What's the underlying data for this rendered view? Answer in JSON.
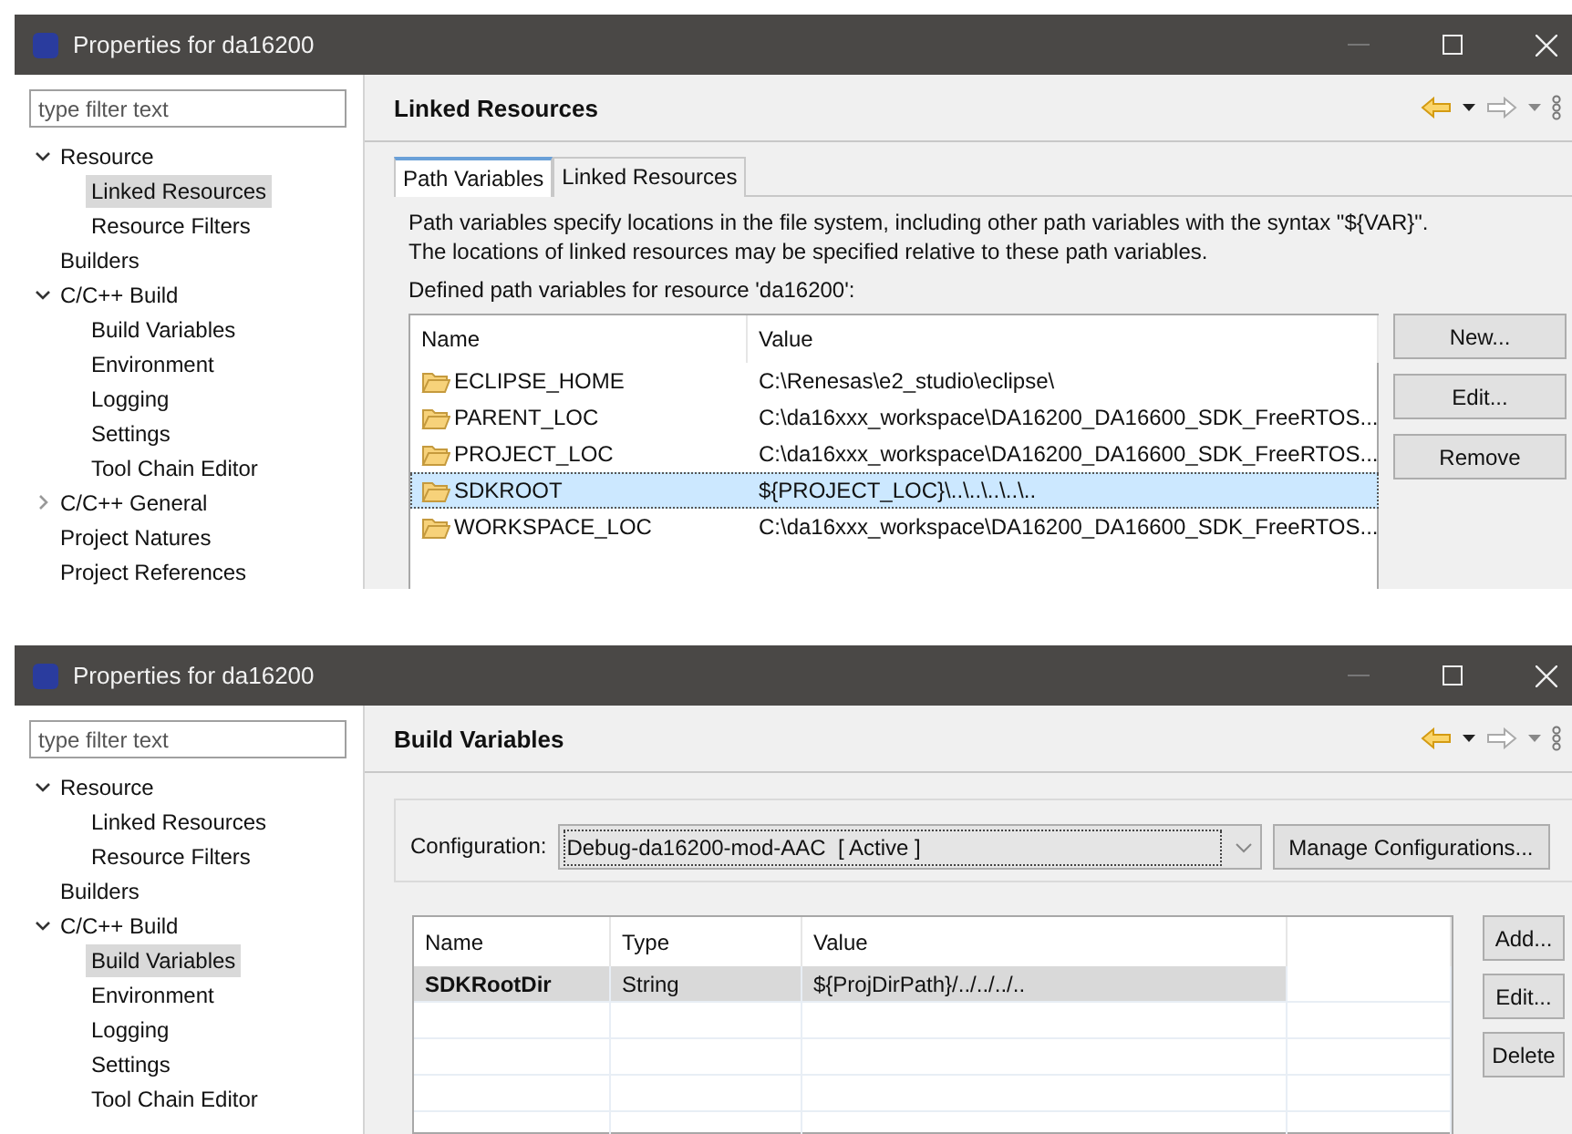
{
  "windows": [
    {
      "title": "Properties for da16200",
      "filter": {
        "placeholder": "type filter text"
      },
      "tree": [
        {
          "label": "Resource",
          "expanded": true,
          "selected": false,
          "children": [
            {
              "label": "Linked Resources",
              "selected": true
            },
            {
              "label": "Resource Filters",
              "selected": false
            }
          ]
        },
        {
          "label": "Builders",
          "selected": false
        },
        {
          "label": "C/C++ Build",
          "expanded": true,
          "selected": false,
          "children": [
            {
              "label": "Build Variables",
              "selected": false
            },
            {
              "label": "Environment",
              "selected": false
            },
            {
              "label": "Logging",
              "selected": false
            },
            {
              "label": "Settings",
              "selected": false
            },
            {
              "label": "Tool Chain Editor",
              "selected": false
            }
          ]
        },
        {
          "label": "C/C++ General",
          "expanded": false,
          "selected": false
        },
        {
          "label": "Project Natures",
          "selected": false
        },
        {
          "label": "Project References",
          "selected": false
        }
      ],
      "page": {
        "kind": "path_variables",
        "heading": "Linked Resources",
        "tabs": [
          {
            "label": "Path Variables",
            "selected": true
          },
          {
            "label": "Linked Resources",
            "selected": false
          }
        ],
        "description": [
          "Path variables specify locations in the file system, including other path variables with the syntax \"${VAR}\".",
          "The locations of linked resources may be specified relative to these path variables."
        ],
        "table_label": "Defined path variables for resource 'da16200':",
        "columns": [
          "Name",
          "Value"
        ],
        "rows": [
          {
            "cells": [
              "ECLIPSE_HOME",
              "C:\\Renesas\\e2_studio\\eclipse\\"
            ],
            "selected": false
          },
          {
            "cells": [
              "PARENT_LOC",
              "C:\\da16xxx_workspace\\DA16200_DA16600_SDK_FreeRTOS..."
            ],
            "selected": false
          },
          {
            "cells": [
              "PROJECT_LOC",
              "C:\\da16xxx_workspace\\DA16200_DA16600_SDK_FreeRTOS..."
            ],
            "selected": false
          },
          {
            "cells": [
              "SDKROOT",
              "${PROJECT_LOC}\\..\\..\\..\\..\\.."
            ],
            "selected": true
          },
          {
            "cells": [
              "WORKSPACE_LOC",
              "C:\\da16xxx_workspace\\DA16200_DA16600_SDK_FreeRTOS..."
            ],
            "selected": false
          }
        ],
        "buttons": [
          "New...",
          "Edit...",
          "Remove"
        ]
      }
    },
    {
      "title": "Properties for da16200",
      "filter": {
        "placeholder": "type filter text"
      },
      "tree": [
        {
          "label": "Resource",
          "expanded": true,
          "selected": false,
          "children": [
            {
              "label": "Linked Resources",
              "selected": false
            },
            {
              "label": "Resource Filters",
              "selected": false
            }
          ]
        },
        {
          "label": "Builders",
          "selected": false
        },
        {
          "label": "C/C++ Build",
          "expanded": true,
          "selected": false,
          "children": [
            {
              "label": "Build Variables",
              "selected": true
            },
            {
              "label": "Environment",
              "selected": false
            },
            {
              "label": "Logging",
              "selected": false
            },
            {
              "label": "Settings",
              "selected": false
            },
            {
              "label": "Tool Chain Editor",
              "selected": false
            }
          ]
        }
      ],
      "page": {
        "kind": "build_variables",
        "heading": "Build Variables",
        "config": {
          "label": "Configuration:",
          "value": "Debug-da16200-mod-AAC  [ Active ]",
          "button": "Manage Configurations..."
        },
        "columns": [
          "Name",
          "Type",
          "Value"
        ],
        "rows": [
          {
            "cells": [
              "SDKRootDir",
              "String",
              "${ProjDirPath}/../../../.."
            ],
            "selected": true
          }
        ],
        "buttons": [
          "Add...",
          "Edit...",
          "Delete"
        ]
      }
    }
  ]
}
